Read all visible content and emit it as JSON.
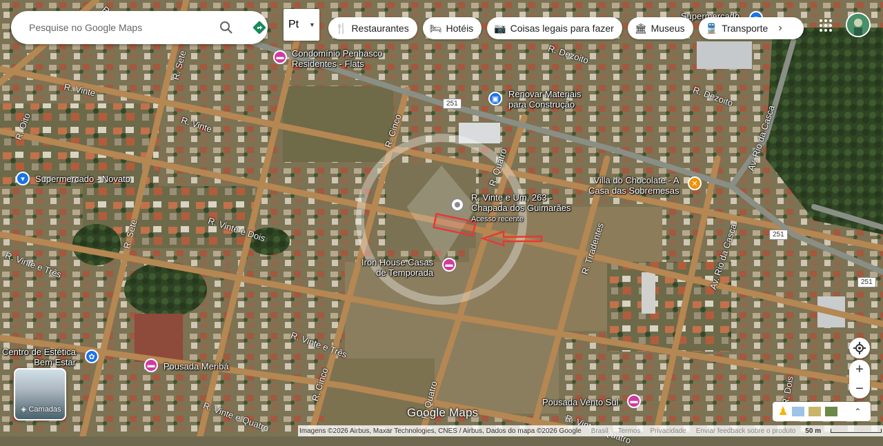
{
  "search": {
    "placeholder": "Pesquise no Google Maps"
  },
  "language_select": {
    "value": "Pt"
  },
  "chips": [
    {
      "icon": "fork-knife-icon",
      "label": "Restaurantes"
    },
    {
      "icon": "bed-icon",
      "label": "Hotéis"
    },
    {
      "icon": "camera-icon",
      "label": "Coisas legais para fazer"
    },
    {
      "icon": "museum-icon",
      "label": "Museus"
    },
    {
      "icon": "train-icon",
      "label": "Transporte p"
    }
  ],
  "places": {
    "condominio": "Condomínio Penhasco\nResidentes - Flats",
    "renovar": "Renovar Materiais\npara Construção",
    "supermercado_novato": "Supermercado - Novato",
    "supermercado_top": "Supermercado",
    "villa_chocolate": "Villa do Chocolate - A\nCasa das Sobremesas",
    "selected_address": "R. Vinte e Um, 263 -\nChapada dos Guimarães",
    "selected_sub": "Acesso recente",
    "iron_house": "Iron House Casas\nde Temporada",
    "centro_estetica": "Centro de Estética\nBem Estar",
    "pousada_meriba": "Pousada Meribá",
    "pousada_vento": "Pousada Vento Sul"
  },
  "streets": {
    "r_seis": "R. Seis",
    "r_sete_top": "R. Sete",
    "r_vinte_a": "R. Vinte",
    "r_vinte_b": "R. Vinte",
    "r_oito": "R. Oito",
    "r_dezoito_a": "R. Dezoito",
    "r_dezoito_b": "R. Dezoito",
    "r_cinco_top": "R. Cinco",
    "r_quatro_top": "R. Quatro",
    "av_rio_casca_top": "Av. Rio da Casca",
    "r_vinte_dois": "R. Vinte e Dois",
    "r_sete_mid": "R. Sete",
    "r_vinte_tres_a": "R. Vinte e Três",
    "r_tiradentes": "R. Tiradentes",
    "av_rio_casca_mid": "Av. Rio da Casca",
    "r_vinte_tres_b": "R. Vinte e Três",
    "r_cinco_bot": "R. Cinco",
    "r_vinte_quatro_a": "R. Vinte e Quatro",
    "r_quatro_bot": "R. Quatro",
    "r_vinte_quatro_b": "R. Vinte e Quatro",
    "r_dois": "R. Dois"
  },
  "route_shields": [
    "251",
    "251",
    "251"
  ],
  "layers_label": "Camadas",
  "logo": "Google Maps",
  "attribution": {
    "imagery": "Imagens ©2026 Airbus, Maxar Technologies, CNES / Airbus, Dados do mapa ©2026 Google",
    "country": "Brasil",
    "terms": "Termos",
    "privacy": "Privacidade",
    "feedback": "Enviar feedback sobre o produto",
    "scale": "50 m"
  },
  "colors": {
    "pin_blue": "#1a73e8",
    "pin_pink": "#d03ba0",
    "pin_orange": "#f29100",
    "selection_red": "#e53935"
  }
}
